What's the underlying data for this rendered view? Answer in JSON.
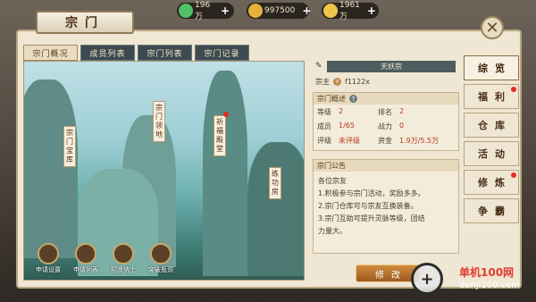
{
  "resources": [
    {
      "icon": "jade-icon",
      "value": "196万"
    },
    {
      "icon": "gold-ingot-icon",
      "value": "997500"
    },
    {
      "icon": "coin-icon",
      "value": "1961万"
    }
  ],
  "title": "宗门",
  "tabs": [
    "宗门概况",
    "成员列表",
    "宗门列表",
    "宗门记录"
  ],
  "scene_labels": {
    "treasury": "宗门宝库",
    "land": "宗门领地",
    "blessing": "祈福殿堂",
    "training": "练功房"
  },
  "bottom_icons": [
    "申请设置",
    "申请列表",
    "招贤纳士",
    "突破瓶颈"
  ],
  "sect": {
    "name": "天妖宗",
    "leader_label": "宗主",
    "leader_name": "f1122x"
  },
  "overview": {
    "title": "宗门概述",
    "level_k": "等级",
    "level_v": "2",
    "rank_k": "排名",
    "rank_v": "2",
    "members_k": "成员",
    "members_v": "1/65",
    "power_k": "战力",
    "power_v": "0",
    "rating_k": "评级",
    "rating_v": "未评级",
    "funds_k": "资金",
    "funds_v": "1.9万/5.5万"
  },
  "notice": {
    "title": "宗门公告",
    "lines": [
      "各位宗友",
      "1.积极参与宗门活动，奖励多多。",
      "2.宗门仓库可与宗友互换装备。",
      "3.宗门互助可提升灵脉等级，团结",
      "力量大。"
    ]
  },
  "side_menu": [
    "综览",
    "福利",
    "仓库",
    "活动",
    "修炼",
    "争霸"
  ],
  "modify_label": "修改",
  "watermark": {
    "line1": "单机100网",
    "line2": "danji100.com"
  }
}
